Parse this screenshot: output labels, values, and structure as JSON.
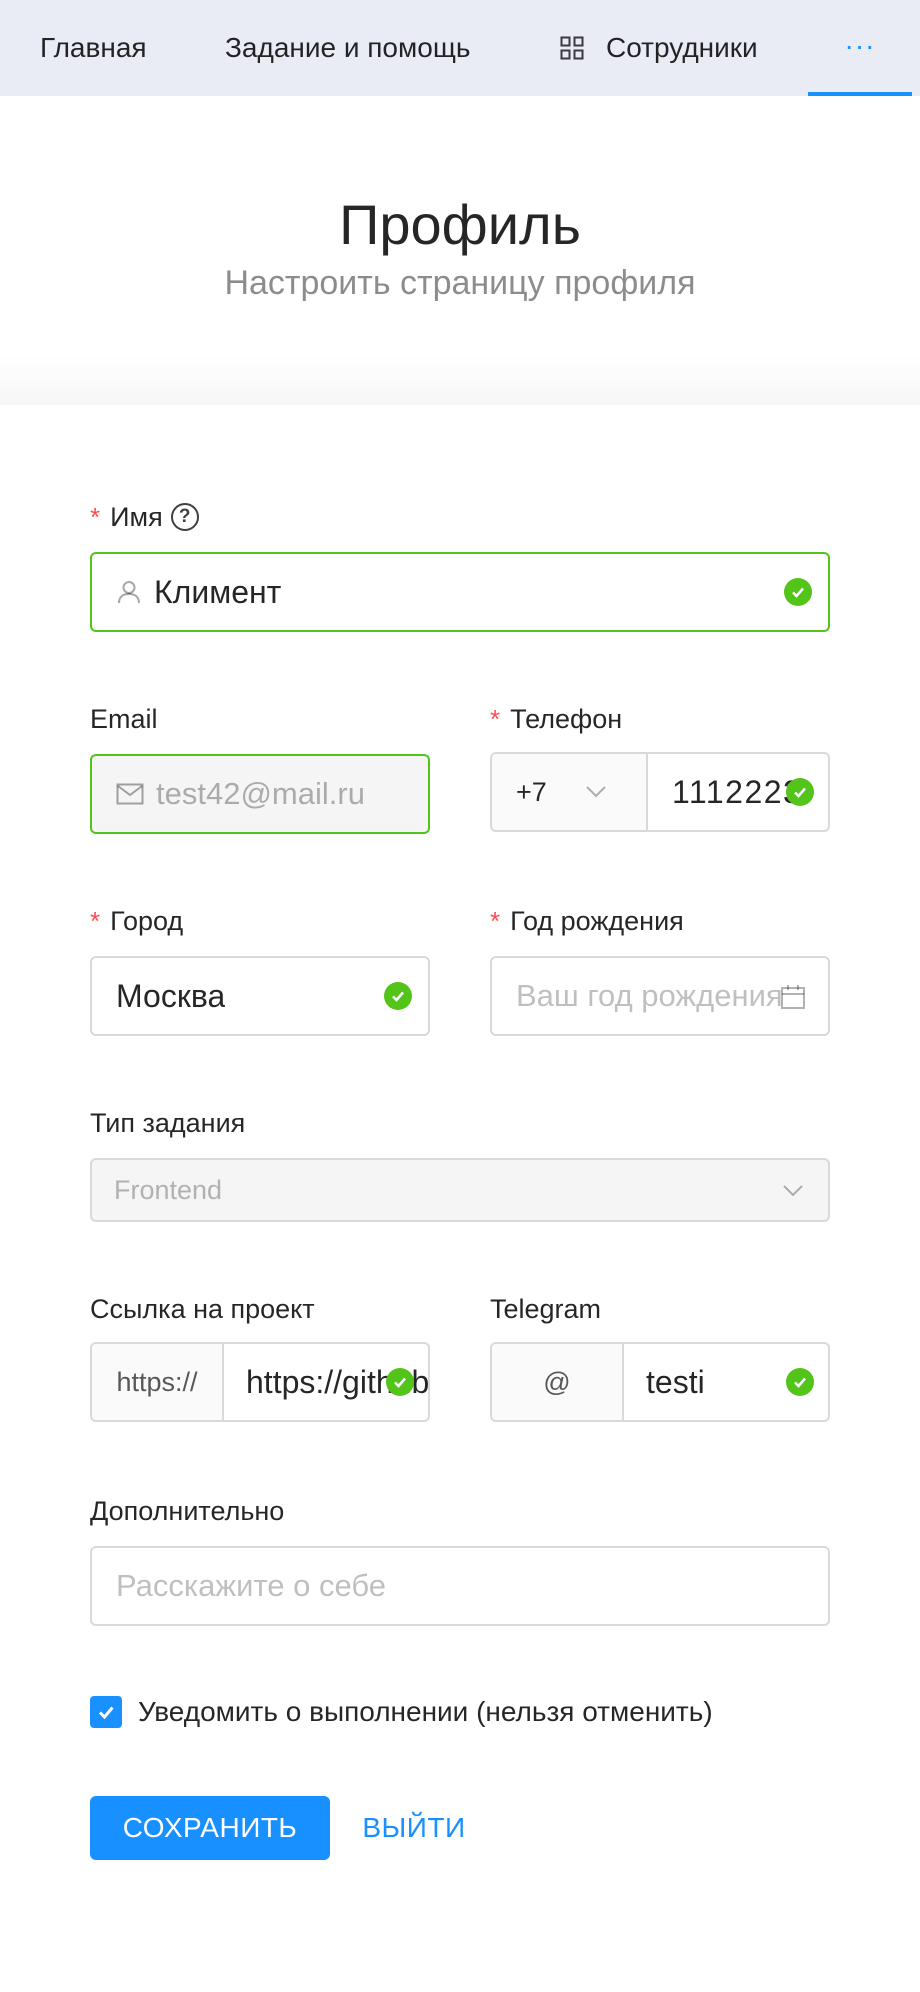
{
  "nav": {
    "items": [
      {
        "label": "Главная"
      },
      {
        "label": "Задание и помощь"
      },
      {
        "label": "Сотрудники",
        "icon": "grid-icon"
      }
    ],
    "more_label": "···",
    "accent": "#1890ff"
  },
  "header": {
    "title": "Профиль",
    "subtitle": "Настроить страницу профиля"
  },
  "form": {
    "name": {
      "label": "Имя",
      "value": "Климент",
      "required": true,
      "valid": true,
      "icon": "user-icon"
    },
    "email": {
      "label": "Email",
      "value": "test42@mail.ru",
      "disabled": true,
      "icon": "mail-icon"
    },
    "phone": {
      "label": "Телефон",
      "prefix": "+7",
      "value": "1112223",
      "required": true,
      "valid": true
    },
    "city": {
      "label": "Город",
      "value": "Москва",
      "required": true,
      "valid": true
    },
    "birth_year": {
      "label": "Год рождения",
      "placeholder": "Ваш год рождения",
      "required": true,
      "icon": "calendar-icon"
    },
    "task_type": {
      "label": "Тип задания",
      "value": "Frontend",
      "disabled": true
    },
    "project_link": {
      "label": "Ссылка на проект",
      "prefix": "https://",
      "value": "https://github",
      "valid": true
    },
    "telegram": {
      "label": "Telegram",
      "prefix": "@",
      "value": "testi",
      "valid": true
    },
    "extra": {
      "label": "Дополнительно",
      "placeholder": "Расскажите о себе"
    },
    "notify": {
      "label": "Уведомить о выполнении (нельзя отменить)",
      "checked": true
    }
  },
  "actions": {
    "save_label": "СОХРАНИТЬ",
    "exit_label": "ВЫЙТИ"
  },
  "colors": {
    "success": "#52c41a",
    "primary": "#1890ff",
    "required": "#ff4d4f"
  }
}
